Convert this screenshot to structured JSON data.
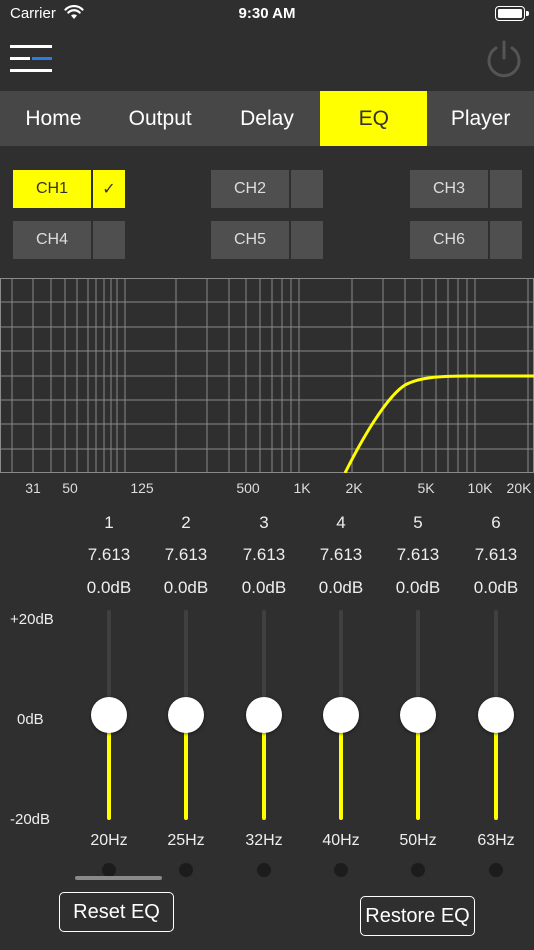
{
  "status": {
    "carrier": "Carrier",
    "time": "9:30 AM"
  },
  "tabs": [
    {
      "label": "Home",
      "active": false
    },
    {
      "label": "Output",
      "active": false
    },
    {
      "label": "Delay",
      "active": false
    },
    {
      "label": "EQ",
      "active": true
    },
    {
      "label": "Player",
      "active": false
    }
  ],
  "channels": [
    {
      "label": "CH1",
      "check": "✓",
      "active": true
    },
    {
      "label": "CH2",
      "check": "",
      "active": false
    },
    {
      "label": "CH3",
      "check": "",
      "active": false
    },
    {
      "label": "CH4",
      "check": "",
      "active": false
    },
    {
      "label": "CH5",
      "check": "",
      "active": false
    },
    {
      "label": "CH6",
      "check": "",
      "active": false
    }
  ],
  "graph": {
    "freq_labels": [
      "31",
      "50",
      "125",
      "500",
      "1K",
      "2K",
      "5K",
      "10K",
      "20K"
    ],
    "curve_color": "#ffff00"
  },
  "db_scale": {
    "top": "+20dB",
    "mid": "0dB",
    "bottom": "-20dB"
  },
  "bands": [
    {
      "num": "1",
      "q": "7.613",
      "gain": "0.0dB",
      "freq": "20Hz",
      "level": 0
    },
    {
      "num": "2",
      "q": "7.613",
      "gain": "0.0dB",
      "freq": "25Hz",
      "level": 0
    },
    {
      "num": "3",
      "q": "7.613",
      "gain": "0.0dB",
      "freq": "32Hz",
      "level": 0
    },
    {
      "num": "4",
      "q": "7.613",
      "gain": "0.0dB",
      "freq": "40Hz",
      "level": 0
    },
    {
      "num": "5",
      "q": "7.613",
      "gain": "0.0dB",
      "freq": "50Hz",
      "level": 0
    },
    {
      "num": "6",
      "q": "7.613",
      "gain": "0.0dB",
      "freq": "63Hz",
      "level": 0
    }
  ],
  "buttons": {
    "reset": "Reset EQ",
    "restore": "Restore EQ"
  },
  "colors": {
    "accent": "#ffff00",
    "background": "#2f2f2f",
    "tabbar": "#474747",
    "button_blue": "#2a7de1"
  }
}
